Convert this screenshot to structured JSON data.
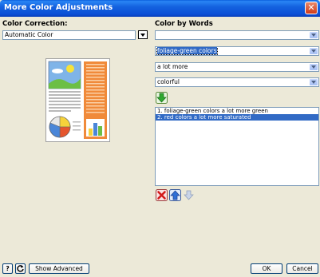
{
  "window": {
    "title": "More Color Adjustments"
  },
  "color_correction": {
    "label": "Color Correction:",
    "value": "Automatic Color",
    "dropdown_icon": "chevron-down-icon"
  },
  "color_by_words": {
    "label": "Color by Words",
    "dropdowns": [
      {
        "value": ""
      },
      {
        "value": "foliage-green colors",
        "highlighted": true
      },
      {
        "value": "a lot more"
      },
      {
        "value": "colorful"
      }
    ],
    "add_icon": "green-down-arrow-icon",
    "list_items": [
      {
        "text": "1.  foliage-green colors a lot more green",
        "selected": false
      },
      {
        "text": "2.  red colors a lot more saturated",
        "selected": true
      }
    ],
    "list_actions": [
      {
        "icon": "delete-icon"
      },
      {
        "icon": "move-up-icon"
      },
      {
        "icon": "move-down-icon",
        "disabled": true
      }
    ]
  },
  "footer": {
    "help_label": "?",
    "reset_icon": "reset-icon",
    "show_advanced_label": "Show Advanced",
    "ok_label": "OK",
    "cancel_label": "Cancel"
  },
  "colors": {
    "titlebar": "#0b4fd6",
    "dialog_bg": "#ece9d8",
    "selection": "#316ac5",
    "close": "#cf3a18"
  }
}
